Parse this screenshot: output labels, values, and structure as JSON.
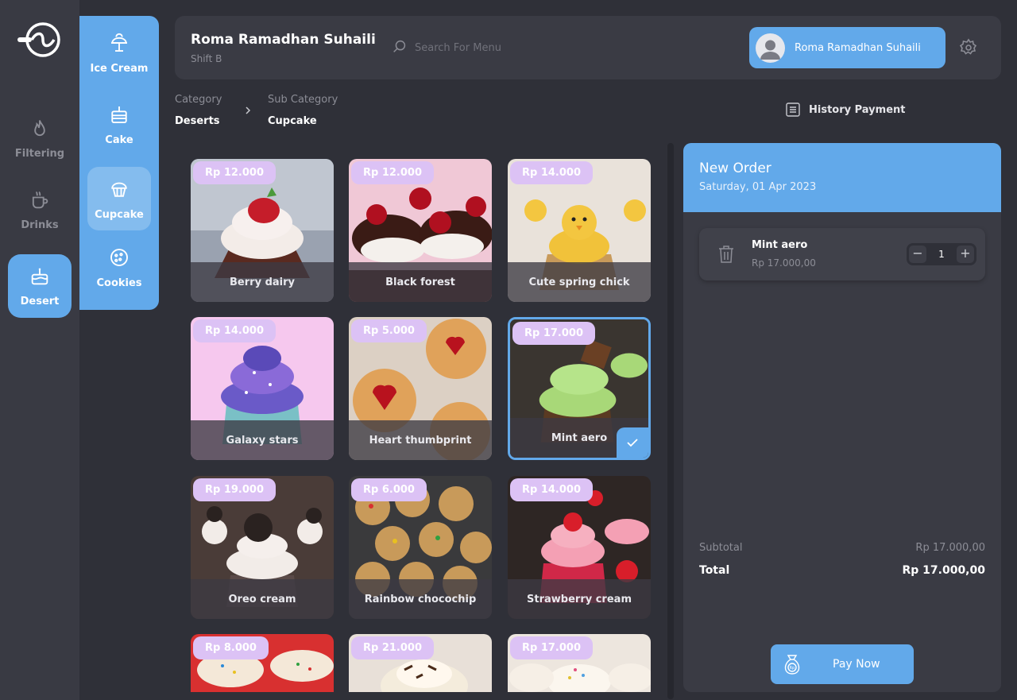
{
  "rail": {
    "items": [
      {
        "label": "Filtering",
        "icon": "flame-icon"
      },
      {
        "label": "Drinks",
        "icon": "cup-icon"
      },
      {
        "label": "Desert",
        "icon": "cake-icon",
        "active": true
      }
    ]
  },
  "subcategories": [
    {
      "label": "Ice Cream",
      "icon": "ice-cream-icon"
    },
    {
      "label": "Cake",
      "icon": "cake-slice-icon"
    },
    {
      "label": "Cupcake",
      "icon": "cupcake-icon",
      "active": true
    },
    {
      "label": "Cookies",
      "icon": "cookie-icon"
    }
  ],
  "header": {
    "user_name": "Roma Ramadhan Suhaili",
    "shift": "Shift B",
    "search_placeholder": "Search For Menu",
    "user_button_label": "Roma Ramadhan Suhaili"
  },
  "breadcrumb": {
    "category_label": "Category",
    "category_value": "Deserts",
    "subcategory_label": "Sub Category",
    "subcategory_value": "Cupcake"
  },
  "history_label": "History Payment",
  "products": [
    {
      "price": "Rp 12.000",
      "name": "Berry dairy"
    },
    {
      "price": "Rp 12.000",
      "name": "Black forest"
    },
    {
      "price": "Rp 14.000",
      "name": "Cute spring chick"
    },
    {
      "price": "Rp 14.000",
      "name": "Galaxy stars"
    },
    {
      "price": "Rp 5.000",
      "name": "Heart thumbprint"
    },
    {
      "price": "Rp 17.000",
      "name": "Mint aero",
      "selected": true
    },
    {
      "price": "Rp 19.000",
      "name": "Oreo cream"
    },
    {
      "price": "Rp 6.000",
      "name": "Rainbow chocochip"
    },
    {
      "price": "Rp 14.000",
      "name": "Strawberry cream"
    },
    {
      "price": "Rp 8.000",
      "name": ""
    },
    {
      "price": "Rp 21.000",
      "name": ""
    },
    {
      "price": "Rp 17.000",
      "name": ""
    }
  ],
  "order": {
    "title": "New Order",
    "date": "Saturday, 01 Apr 2023",
    "items": [
      {
        "name": "Mint aero",
        "price": "Rp 17.000,00",
        "qty": "1"
      }
    ],
    "subtotal_label": "Subtotal",
    "subtotal_value": "Rp 17.000,00",
    "total_label": "Total",
    "total_value": "Rp 17.000,00",
    "pay_label": "Pay Now"
  },
  "colors": {
    "accent": "#62a9ea",
    "price_badge": "#dcc2f5",
    "background": "#2f3038",
    "panel": "#3a3b44"
  }
}
